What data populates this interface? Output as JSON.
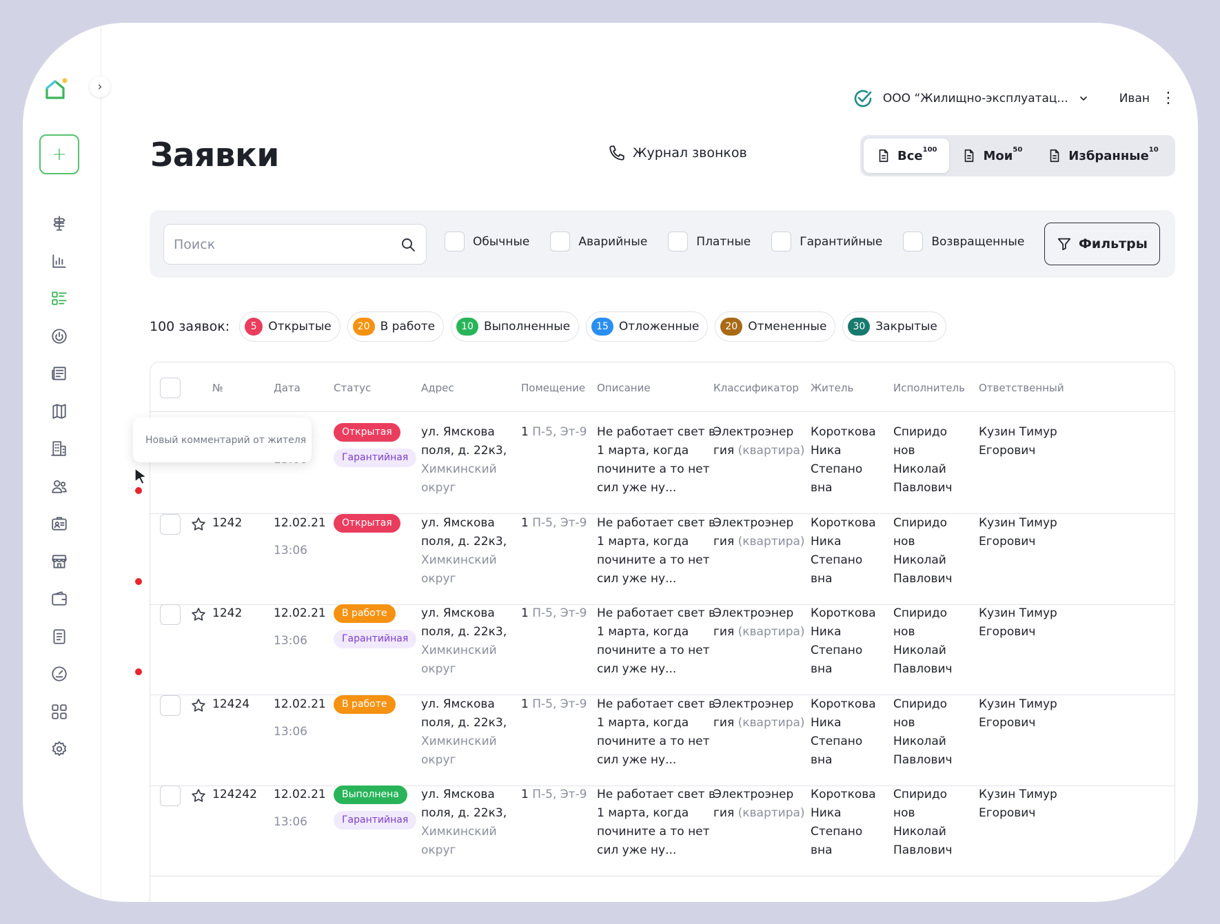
{
  "header": {
    "org": "ООО “Жилищно-эксплуатац...",
    "user": "Иван"
  },
  "page": {
    "title": "Заявки",
    "call_log": "Журнал звонков"
  },
  "view_tabs": [
    {
      "label": "Все",
      "count": "100",
      "active": true
    },
    {
      "label": "Мои",
      "count": "50",
      "active": false
    },
    {
      "label": "Избранные",
      "count": "10",
      "active": false
    }
  ],
  "search": {
    "placeholder": "Поиск"
  },
  "type_filters": [
    "Обычные",
    "Аварийные",
    "Платные",
    "Гарантийные",
    "Возвращенные"
  ],
  "filters_button": "Фильтры",
  "summary": {
    "label": "100 заявок:",
    "chips": [
      {
        "count": "5",
        "label": "Открытые",
        "color": "#ea3d5e"
      },
      {
        "count": "20",
        "label": "В работе",
        "color": "#f59211"
      },
      {
        "count": "10",
        "label": "Выполненные",
        "color": "#29b45a"
      },
      {
        "count": "15",
        "label": "Отложенные",
        "color": "#2a8ff0"
      },
      {
        "count": "20",
        "label": "Отмененные",
        "color": "#a86a16"
      },
      {
        "count": "30",
        "label": "Закрытые",
        "color": "#177a6e"
      }
    ]
  },
  "table": {
    "columns": [
      "№",
      "Дата",
      "Статус",
      "Адрес",
      "Помещение",
      "Описание",
      "Классификатор",
      "Житель",
      "Исполнитель",
      "Ответственный"
    ],
    "rows": [
      {
        "num": "",
        "date": ".2.21",
        "time": "13:06",
        "status": "Открытая",
        "status_type": "open",
        "warranty": "Гарантийная",
        "addr1": "ул. Ямскова",
        "addr2": "поля, д. 22к3,",
        "addr3": "Химкинский",
        "addr4": "округ",
        "room_num": "1",
        "room_rest": "П-5, Эт-9",
        "desc1": "Не работает свет в",
        "desc2": "1 марта, когда",
        "desc3": "починитe а то нет",
        "desc4": "сил уже ну...",
        "class1": "Электроэнер",
        "class2": "гия",
        "class3": "(квартира)",
        "res1": "Короткова",
        "res2": "Ника",
        "res3": "Степано",
        "res4": "вна",
        "exec1": "Спиридо",
        "exec2": "нов",
        "exec3": "Николай",
        "exec4": "Павлович",
        "resp1": "Кузин Тимур",
        "resp2": "Егорович",
        "new_comment": true
      },
      {
        "num": "1242",
        "date": "12.02.21",
        "time": "13:06",
        "status": "Открытая",
        "status_type": "open",
        "warranty": "",
        "addr1": "ул. Ямскова",
        "addr2": "поля, д. 22к3,",
        "addr3": "Химкинский",
        "addr4": "округ",
        "room_num": "1",
        "room_rest": "П-5, Эт-9",
        "desc1": "Не работает свет в",
        "desc2": "1 марта, когда",
        "desc3": "починитe а то нет",
        "desc4": "сил уже ну...",
        "class1": "Электроэнер",
        "class2": "гия",
        "class3": "(квартира)",
        "res1": "Короткова",
        "res2": "Ника",
        "res3": "Степано",
        "res4": "вна",
        "exec1": "Спиридо",
        "exec2": "нов",
        "exec3": "Николай",
        "exec4": "Павлович",
        "resp1": "Кузин Тимур",
        "resp2": "Егорович",
        "new_comment": true
      },
      {
        "num": "1242",
        "date": "12.02.21",
        "time": "13:06",
        "status": "В работе",
        "status_type": "work",
        "warranty": "Гарантийная",
        "addr1": "ул. Ямскова",
        "addr2": "поля, д. 22к3,",
        "addr3": "Химкинский",
        "addr4": "округ",
        "room_num": "1",
        "room_rest": "П-5, Эт-9",
        "desc1": "Не работает свет в",
        "desc2": "1 марта, когда",
        "desc3": "починитe а то нет",
        "desc4": "сил уже ну...",
        "class1": "Электроэнер",
        "class2": "гия",
        "class3": "(квартира)",
        "res1": "Короткова",
        "res2": "Ника",
        "res3": "Степано",
        "res4": "вна",
        "exec1": "Спиридо",
        "exec2": "нов",
        "exec3": "Николай",
        "exec4": "Павлович",
        "resp1": "Кузин Тимур",
        "resp2": "Егорович",
        "new_comment": true
      },
      {
        "num": "12424",
        "date": "12.02.21",
        "time": "13:06",
        "status": "В работе",
        "status_type": "work",
        "warranty": "",
        "addr1": "ул. Ямскова",
        "addr2": "поля, д. 22к3,",
        "addr3": "Химкинский",
        "addr4": "округ",
        "room_num": "1",
        "room_rest": "П-5, Эт-9",
        "desc1": "Не работает свет в",
        "desc2": "1 марта, когда",
        "desc3": "починитe а то нет",
        "desc4": "сил уже ну...",
        "class1": "Электроэнер",
        "class2": "гия",
        "class3": "(квартира)",
        "res1": "Короткова",
        "res2": "Ника",
        "res3": "Степано",
        "res4": "вна",
        "exec1": "Спиридо",
        "exec2": "нов",
        "exec3": "Николай",
        "exec4": "Павлович",
        "resp1": "Кузин Тимур",
        "resp2": "Егорович",
        "new_comment": false
      },
      {
        "num": "124242",
        "date": "12.02.21",
        "time": "13:06",
        "status": "Выполнена",
        "status_type": "done",
        "warranty": "Гарантийная",
        "addr1": "ул. Ямскова",
        "addr2": "поля, д. 22к3,",
        "addr3": "Химкинский",
        "addr4": "округ",
        "room_num": "1",
        "room_rest": "П-5, Эт-9",
        "desc1": "Не работает свет в",
        "desc2": "1 марта, когда",
        "desc3": "починитe а то нет",
        "desc4": "сил уже ну...",
        "class1": "Электроэнер",
        "class2": "гия",
        "class3": "(квартира)",
        "res1": "Короткова",
        "res2": "Ника",
        "res3": "Степано",
        "res4": "вна",
        "exec1": "Спиридо",
        "exec2": "нов",
        "exec3": "Николай",
        "exec4": "Павлович",
        "resp1": "Кузин Тимур",
        "resp2": "Егорович",
        "new_comment": false
      }
    ]
  },
  "tooltip": "Новый комментарий от жителя",
  "colors": {
    "accent": "#3cb55b",
    "open": "#ea3d5e",
    "work": "#f59211",
    "done": "#29b45a",
    "warranty_bg": "#f1e9fc",
    "dot": "#e8262d"
  }
}
